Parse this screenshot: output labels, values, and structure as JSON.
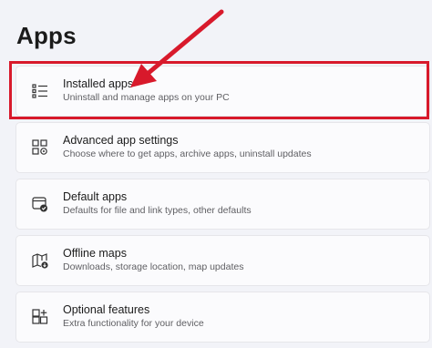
{
  "page": {
    "title": "Apps"
  },
  "items": [
    {
      "label": "Installed apps",
      "description": "Uninstall and manage apps on your PC",
      "icon": "list-icon",
      "highlighted": true
    },
    {
      "label": "Advanced app settings",
      "description": "Choose where to get apps, archive apps, uninstall updates",
      "icon": "settings-app-icon",
      "highlighted": false
    },
    {
      "label": "Default apps",
      "description": "Defaults for file and link types, other defaults",
      "icon": "default-app-icon",
      "highlighted": false
    },
    {
      "label": "Offline maps",
      "description": "Downloads, storage location, map updates",
      "icon": "offline-map-icon",
      "highlighted": false
    },
    {
      "label": "Optional features",
      "description": "Extra functionality for your device",
      "icon": "add-features-icon",
      "highlighted": false
    }
  ],
  "annotation": {
    "color": "#d8192b"
  }
}
